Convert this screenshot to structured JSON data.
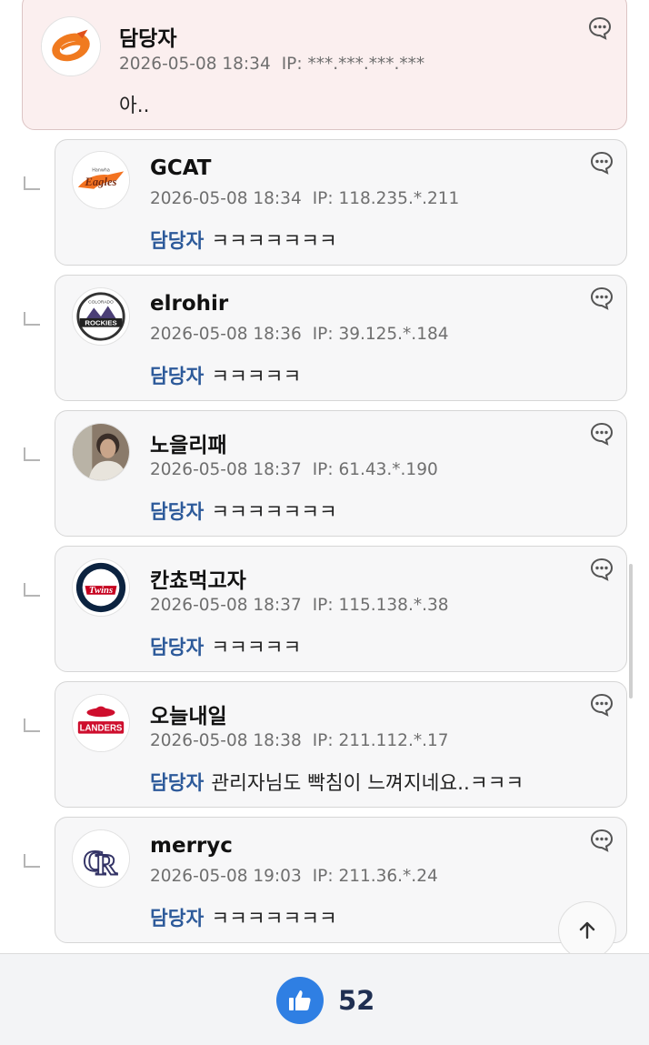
{
  "original_post": {
    "nickname": "담당자",
    "date": "2026-05-08 18:34",
    "ip": "IP: ***.***.***.***",
    "text": "아..",
    "avatar_icon": "eagle-e-logo-icon"
  },
  "comments": [
    {
      "nickname": "GCAT",
      "date": "2026-05-08 18:34",
      "ip": "IP: 118.235.*.211",
      "mention": "담당자",
      "text": "ㅋㅋㅋㅋㅋㅋㅋ",
      "avatar_icon": "hanwha-eagles-logo-icon"
    },
    {
      "nickname": "elrohir",
      "date": "2026-05-08 18:36",
      "ip": "IP: 39.125.*.184",
      "mention": "담당자",
      "text": "ㅋㅋㅋㅋㅋ",
      "avatar_icon": "colorado-rockies-logo-icon"
    },
    {
      "nickname": "노을리패",
      "date": "2026-05-08 18:37",
      "ip": "IP: 61.43.*.190",
      "mention": "담당자",
      "text": "ㅋㅋㅋㅋㅋㅋㅋ",
      "avatar_icon": "user-photo-avatar"
    },
    {
      "nickname": "칸쵸먹고자",
      "date": "2026-05-08 18:37",
      "ip": "IP: 115.138.*.38",
      "mention": "담당자",
      "text": "ㅋㅋㅋㅋㅋ",
      "avatar_icon": "minnesota-twins-logo-icon"
    },
    {
      "nickname": "오늘내일",
      "date": "2026-05-08 18:38",
      "ip": "IP: 211.112.*.17",
      "mention": "담당자",
      "text": "관리자님도 빡침이 느껴지네요..ㅋㅋㅋ",
      "avatar_icon": "ssg-landers-logo-icon"
    },
    {
      "nickname": "merryc",
      "date": "2026-05-08 19:03",
      "ip": "IP: 211.36.*.24",
      "mention": "담당자",
      "text": "ㅋㅋㅋㅋㅋㅋㅋ",
      "avatar_icon": "rockies-cr-logo-icon"
    }
  ],
  "like_bar": {
    "count": "52",
    "icon": "thumbs-up-icon",
    "accent": "#2f7fe3"
  },
  "scroll_top_icon": "arrow-up-icon",
  "colors": {
    "mention": "#2d5a9a",
    "op_card_bg": "#fbefef",
    "reply_card_bg": "#f7f7f8"
  }
}
